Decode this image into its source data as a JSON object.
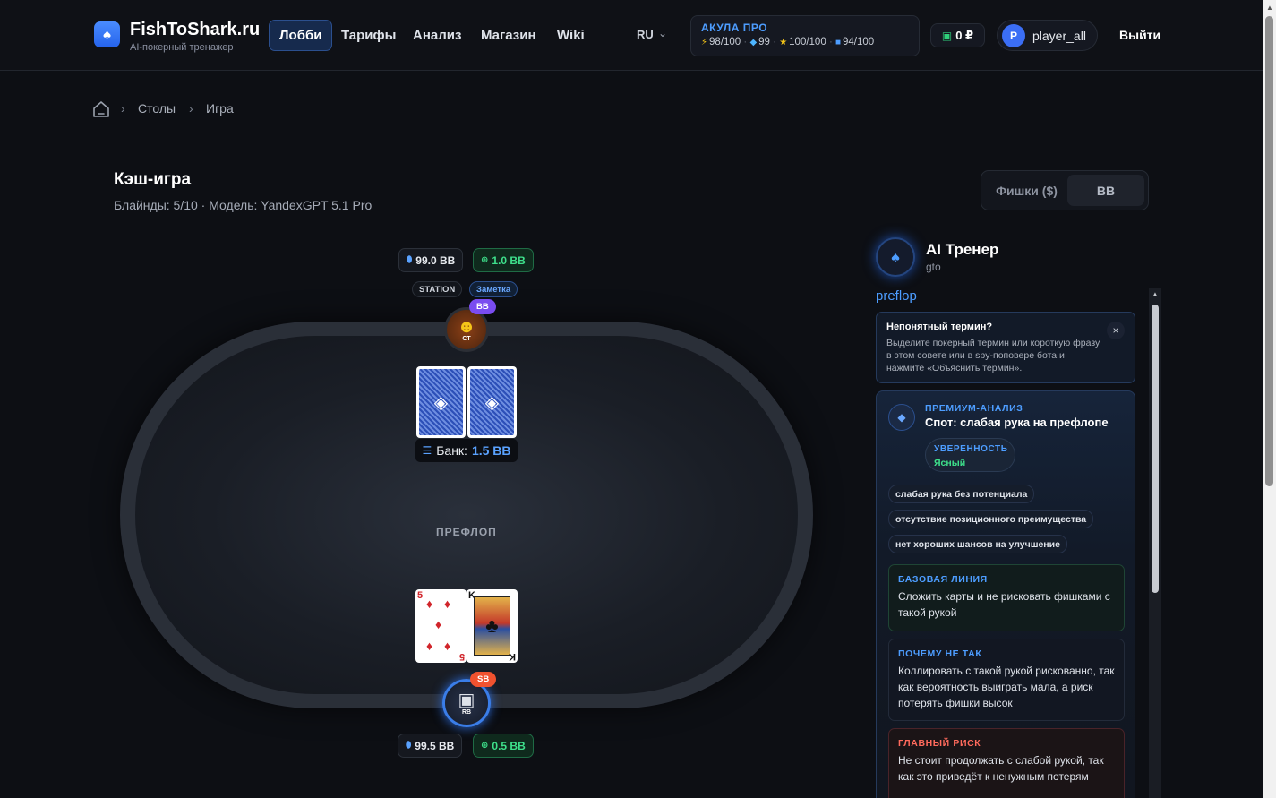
{
  "header": {
    "logo_icon": "spade-icon",
    "brand": "FishToShark.ru",
    "tagline": "AI-покерный тренажер",
    "nav": [
      {
        "label": "Лобби",
        "active": true
      },
      {
        "label": "Тарифы",
        "active": false
      },
      {
        "label": "Анализ",
        "active": false
      },
      {
        "label": "Магазин",
        "active": false
      },
      {
        "label": "Wiki",
        "active": false
      }
    ],
    "lang": "RU",
    "plan": {
      "title": "АКУЛА ПРО",
      "stats": [
        {
          "icon": "bolt-icon",
          "value": "98/100"
        },
        {
          "icon": "gem-icon",
          "value": "99"
        },
        {
          "icon": "star-icon",
          "value": "100/100"
        },
        {
          "icon": "spade-icon",
          "value": "94/100"
        }
      ]
    },
    "wallet": "0 ₽",
    "user": {
      "initial": "P",
      "name": "player_all"
    },
    "logout": "Выйти"
  },
  "breadcrumb": [
    "Столы",
    "Игра"
  ],
  "game": {
    "title": "Кэш-игра",
    "subtitle": "Блайнды: 5/10 · Модель: YandexGPT 5.1 Pro"
  },
  "unit_toggle": {
    "options": [
      "Фишки ($)",
      "BB"
    ],
    "selected": "BB"
  },
  "table": {
    "street": "ПРЕФЛОП",
    "pot_label": "Банк:",
    "pot_value": "1.5 BB",
    "top_player": {
      "stack": "99.0 BB",
      "bet": "1.0 BB",
      "style_tag": "STATION",
      "note_tag": "Заметка",
      "position": "BB",
      "avatar_label": "CT",
      "cards": "hidden"
    },
    "hero": {
      "stack": "99.5 BB",
      "bet": "0.5 BB",
      "position": "SB",
      "avatar_label": "RB",
      "cards": [
        {
          "rank": "5",
          "suit": "♦"
        },
        {
          "rank": "K",
          "suit": "♣"
        }
      ]
    }
  },
  "coach": {
    "title": "AI Тренер",
    "mode": "gto",
    "street": "preflop",
    "hint": {
      "title": "Непонятный термин?",
      "text": "Выделите покерный термин или короткую фразу в этом совете или в spy-поповере бота и нажмите «Объяснить термин»."
    },
    "premium": {
      "label": "ПРЕМИУМ-АНАЛИЗ",
      "title": "Спот: слабая рука на префлопе",
      "confidence_label": "УВЕРЕННОСТЬ",
      "confidence_value": "Ясный",
      "tags": [
        "слабая рука без потенциала",
        "отсутствие позиционного преимущества",
        "нет хороших шансов на улучшение"
      ],
      "sections": [
        {
          "label": "БАЗОВАЯ ЛИНИЯ",
          "text": "Сложить карты и не рисковать фишками с такой рукой"
        },
        {
          "label": "ПОЧЕМУ НЕ ТАК",
          "text": "Коллировать с такой рукой рискованно, так как вероятность выиграть мала, а риск потерять фишки высок"
        },
        {
          "label": "ГЛАВНЫЙ РИСК",
          "text": "Не стоит продолжать с слабой рукой, так как это приведёт к ненужным потерям"
        }
      ]
    }
  }
}
